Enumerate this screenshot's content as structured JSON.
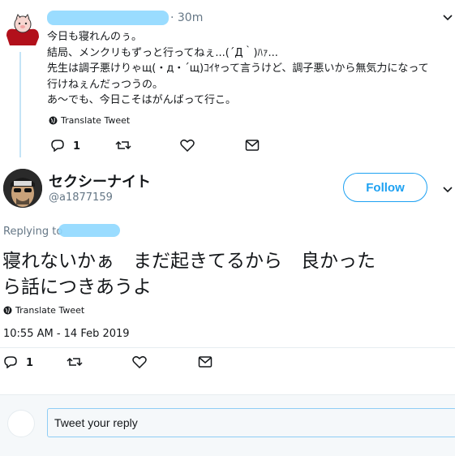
{
  "parent_tweet": {
    "time": "· 30m",
    "lines": [
      "今日も寝れんのぅ。",
      "結局、メンクリもずっと行ってねぇ...(´Д｀)ﾊｧ...",
      "先生は調子悪けりゃщ(・д・´щ)ｺｲﾔって言うけど、調子悪いから無気力になって",
      "行けねぇんだっつうの。",
      "あ〜でも、今日こそはがんばって行こ。"
    ],
    "translate": "Translate Tweet",
    "reply_count": "1"
  },
  "main_tweet": {
    "display_name": "セクシーナイト",
    "handle": "@a1877159",
    "follow_label": "Follow",
    "replying_to": "Replying to",
    "text_line1": "寝れないかぁ　まだ起きてるから　良かった",
    "text_line2": "ら話につきあうよ",
    "translate": "Translate Tweet",
    "timestamp": "10:55 AM - 14 Feb 2019",
    "reply_count": "1"
  },
  "reply": {
    "placeholder": "Tweet your reply"
  },
  "colors": {
    "accent": "#1da1f2",
    "thread_line": "#c4e4f7",
    "muted": "#657786"
  }
}
